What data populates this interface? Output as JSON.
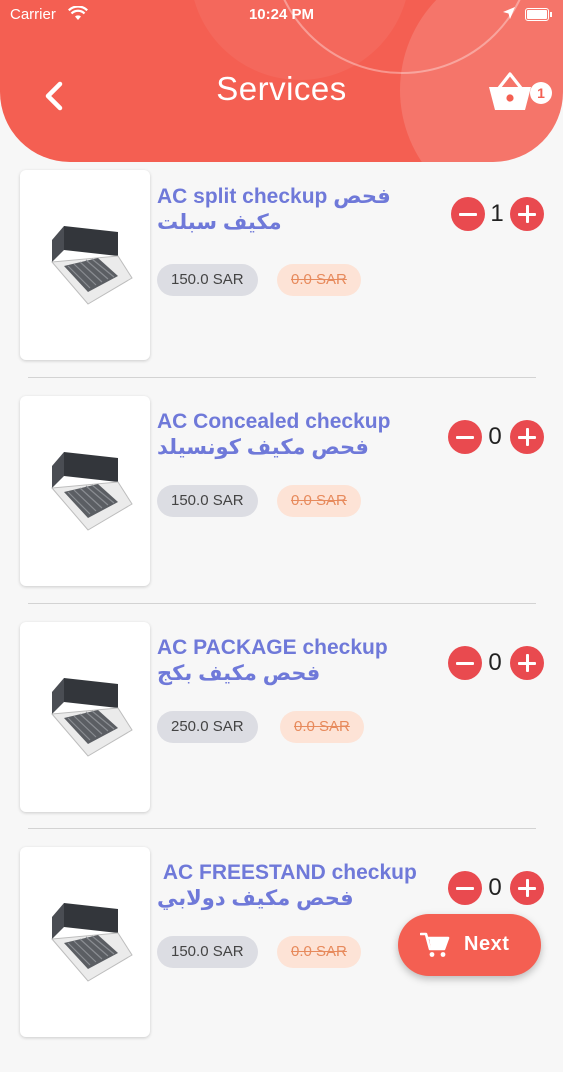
{
  "status_bar": {
    "carrier": "Carrier",
    "time": "10:24 PM"
  },
  "header": {
    "title": "Services",
    "cart_count": "1"
  },
  "colors": {
    "primary": "#f45f52",
    "title_text": "#6f79d9",
    "qty_buttons": "#e94a4f"
  },
  "services": [
    {
      "name": "AC split checkup  فحص مكيف سبلت",
      "price": "150.0 SAR",
      "old_price": "0.0 SAR",
      "quantity": "1"
    },
    {
      "name": "AC  Concealed checkup فحص مكيف كونسيلد",
      "price": "150.0 SAR",
      "old_price": "0.0 SAR",
      "quantity": "0"
    },
    {
      "name": "AC PACKAGE checkup فحص مكيف بكج",
      "price": "250.0 SAR",
      "old_price": "0.0 SAR",
      "quantity": "0"
    },
    {
      "name": " AC FREESTAND checkup  فحص مكيف دولابي",
      "price": "150.0 SAR",
      "old_price": "0.0 SAR",
      "quantity": "0"
    }
  ],
  "next_button": {
    "label": "Next",
    "icon": "cart-icon"
  }
}
